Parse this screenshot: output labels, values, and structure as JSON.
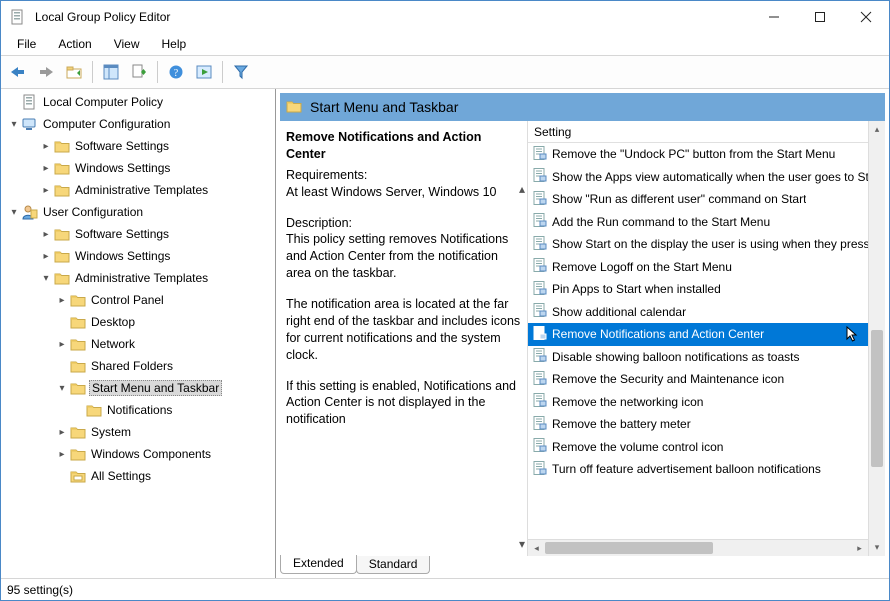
{
  "window": {
    "title": "Local Group Policy Editor"
  },
  "menu": [
    "File",
    "Action",
    "View",
    "Help"
  ],
  "tree": [
    {
      "depth": 0,
      "twisty": "",
      "icon": "policy-doc",
      "label": "Local Computer Policy"
    },
    {
      "depth": 0,
      "twisty": "v",
      "icon": "computer",
      "label": "Computer Configuration"
    },
    {
      "depth": 2,
      "twisty": ">",
      "icon": "folder",
      "label": "Software Settings"
    },
    {
      "depth": 2,
      "twisty": ">",
      "icon": "folder",
      "label": "Windows Settings"
    },
    {
      "depth": 2,
      "twisty": ">",
      "icon": "folder",
      "label": "Administrative Templates"
    },
    {
      "depth": 0,
      "twisty": "v",
      "icon": "user",
      "label": "User Configuration"
    },
    {
      "depth": 2,
      "twisty": ">",
      "icon": "folder",
      "label": "Software Settings"
    },
    {
      "depth": 2,
      "twisty": ">",
      "icon": "folder",
      "label": "Windows Settings"
    },
    {
      "depth": 2,
      "twisty": "v",
      "icon": "folder",
      "label": "Administrative Templates"
    },
    {
      "depth": 3,
      "twisty": ">",
      "icon": "folder",
      "label": "Control Panel"
    },
    {
      "depth": 3,
      "twisty": "",
      "icon": "folder",
      "label": "Desktop"
    },
    {
      "depth": 3,
      "twisty": ">",
      "icon": "folder",
      "label": "Network"
    },
    {
      "depth": 3,
      "twisty": "",
      "icon": "folder",
      "label": "Shared Folders"
    },
    {
      "depth": 3,
      "twisty": "v",
      "icon": "folder",
      "label": "Start Menu and Taskbar",
      "selected": true
    },
    {
      "depth": 4,
      "twisty": "",
      "icon": "folder",
      "label": "Notifications"
    },
    {
      "depth": 3,
      "twisty": ">",
      "icon": "folder",
      "label": "System"
    },
    {
      "depth": 3,
      "twisty": ">",
      "icon": "folder",
      "label": "Windows Components"
    },
    {
      "depth": 3,
      "twisty": "",
      "icon": "allsettings",
      "label": "All Settings"
    }
  ],
  "details": {
    "header": "Start Menu and Taskbar",
    "selected_title": "Remove Notifications and Action Center",
    "req_label": "Requirements:",
    "req_text": "At least Windows Server, Windows 10",
    "desc_label": "Description:",
    "desc_p1": "This policy setting removes Notifications and Action Center from the notification area on the taskbar.",
    "desc_p2": "The notification area is located at the far right end of the taskbar and includes icons for current notifications and the system clock.",
    "desc_p3": "If this setting is enabled, Notifications and Action Center is not displayed in the notification"
  },
  "list": {
    "column": "Setting",
    "items": [
      "Remove the \"Undock PC\" button from the Start Menu",
      "Show the Apps view automatically when the user goes to Start",
      "Show \"Run as different user\" command on Start",
      "Add the Run command to the Start Menu",
      "Show Start on the display the user is using when they press the Windows logo key",
      "Remove Logoff on the Start Menu",
      "Pin Apps to Start when installed",
      "Show additional calendar",
      "Remove Notifications and Action Center",
      "Disable showing balloon notifications as toasts",
      "Remove the Security and Maintenance icon",
      "Remove the networking icon",
      "Remove the battery meter",
      "Remove the volume control icon",
      "Turn off feature advertisement balloon notifications"
    ],
    "selected_index": 8
  },
  "tabs": {
    "extended": "Extended",
    "standard": "Standard"
  },
  "status": "95 setting(s)"
}
